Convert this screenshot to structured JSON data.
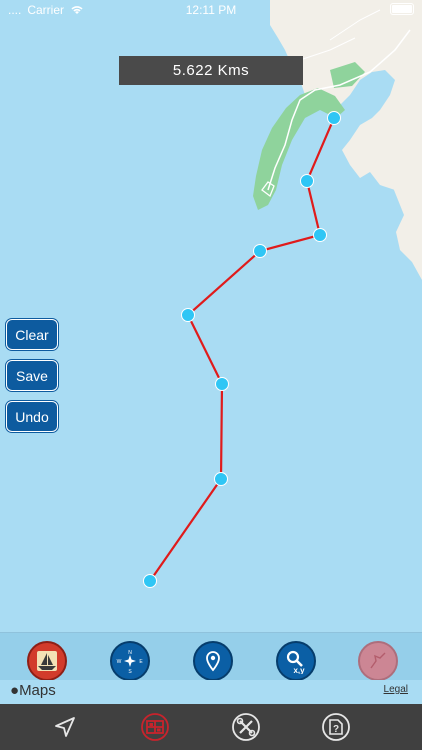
{
  "status_bar": {
    "dots": "....",
    "carrier": "Carrier",
    "time": "12:11 PM"
  },
  "distance": {
    "text": "5.622 Kms"
  },
  "side_buttons": {
    "clear": "Clear",
    "save": "Save",
    "undo": "Undo"
  },
  "map": {
    "attribution": "Maps",
    "legal": "Legal"
  },
  "toolbar": {
    "items": [
      {
        "name": "boat-icon",
        "color": "#d23b2b"
      },
      {
        "name": "compass-icon",
        "color": "#0b5fa5"
      },
      {
        "name": "location-pin-icon",
        "color": "#0b5fa5"
      },
      {
        "name": "xy-search-icon",
        "color": "#0b5fa5"
      },
      {
        "name": "route-icon-disabled",
        "color": "#d67a86"
      }
    ]
  },
  "tabbar": {
    "items": [
      {
        "name": "navigate-icon"
      },
      {
        "name": "tracks-icon",
        "color": "#c8232c"
      },
      {
        "name": "tools-icon"
      },
      {
        "name": "help-icon"
      }
    ]
  },
  "colors": {
    "water": "#a9dcf3",
    "land": "#f2efe8",
    "park": "#8fd39c",
    "route": "#e01b1b",
    "waypoint": "#2fc6f5"
  }
}
